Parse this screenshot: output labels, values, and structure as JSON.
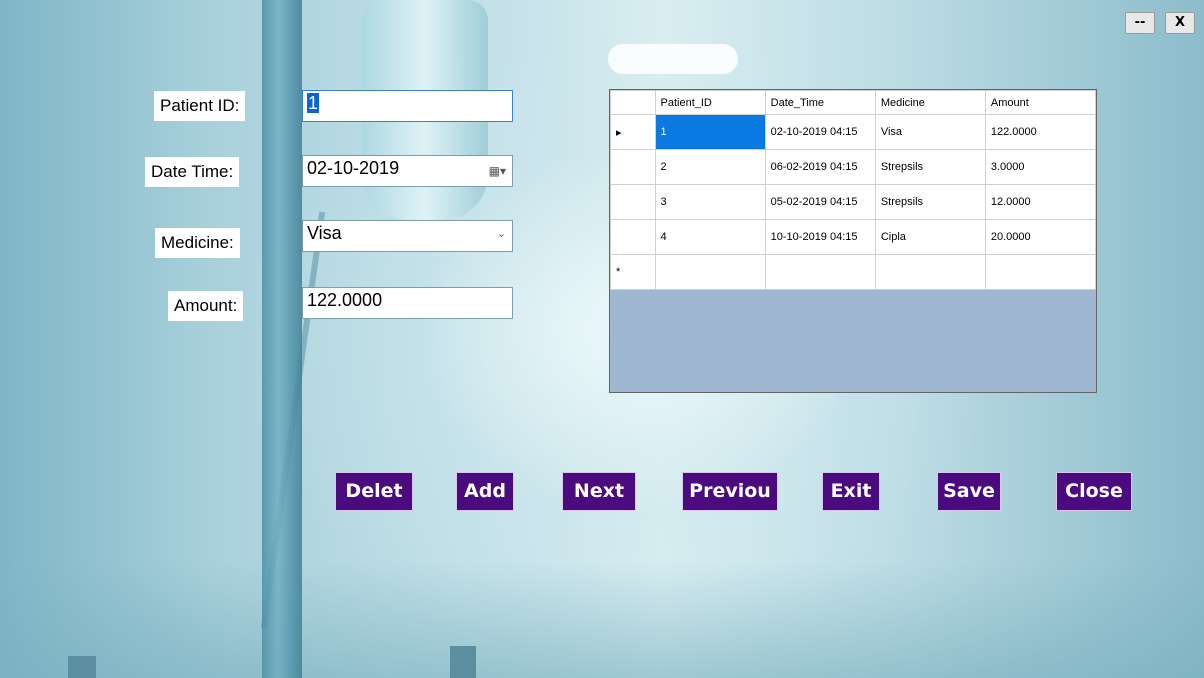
{
  "window": {
    "minimize_label": "--",
    "close_label": "X"
  },
  "form": {
    "patient_id": {
      "label": "Patient ID:",
      "value": "1"
    },
    "date_time": {
      "label": "Date Time:",
      "value": "02-10-2019"
    },
    "medicine": {
      "label": "Medicine:",
      "value": "Visa"
    },
    "amount": {
      "label": "Amount:",
      "value": "122.0000"
    }
  },
  "grid": {
    "columns": [
      "Patient_ID",
      "Date_Time",
      "Medicine",
      "Amount"
    ],
    "rows": [
      [
        "1",
        "02-10-2019 04:15",
        "Visa",
        "122.0000"
      ],
      [
        "2",
        "06-02-2019 04:15",
        "Strepsils",
        "3.0000"
      ],
      [
        "3",
        "05-02-2019 04:15",
        "Strepsils",
        "12.0000"
      ],
      [
        "4",
        "10-10-2019 04:15",
        "Cipla",
        "20.0000"
      ]
    ],
    "current_row_marker": "▸",
    "new_row_marker": "*"
  },
  "buttons": {
    "delete": "Delet",
    "add": "Add",
    "next": "Next",
    "previous": "Previou",
    "exit": "Exit",
    "save": "Save",
    "close": "Close"
  },
  "colors": {
    "button_bg": "#4b0a7e",
    "selection": "#0a7ae2"
  },
  "icons": {
    "combo": "chevron-down-icon",
    "date": "calendar-icon"
  }
}
